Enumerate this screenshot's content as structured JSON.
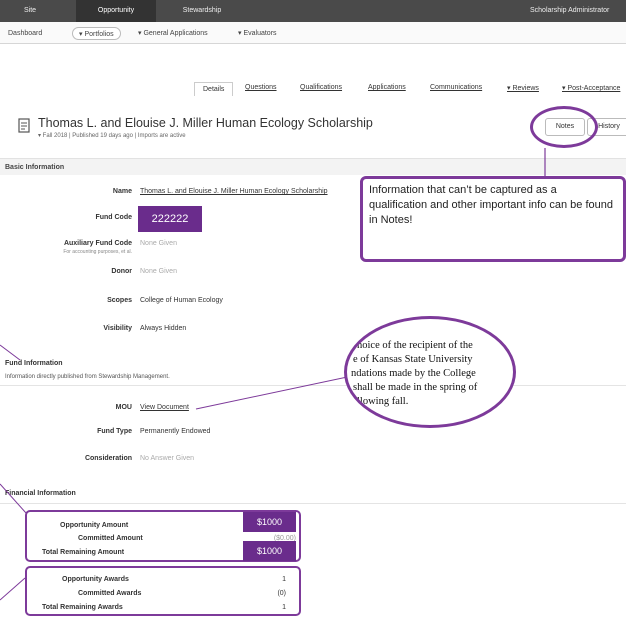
{
  "topnav": {
    "items": [
      {
        "label": "Site",
        "active": false
      },
      {
        "label": "Opportunity",
        "active": true
      },
      {
        "label": "Stewardship",
        "active": false
      }
    ],
    "right_label": "Scholarship Administrator"
  },
  "subnav": {
    "items": [
      "Dashboard",
      "▾ Portfolios",
      "▾ General Applications",
      "▾ Evaluators"
    ]
  },
  "tabs": [
    "Details",
    "Questions",
    "Qualifications",
    "Applications",
    "Communications",
    "▾ Reviews",
    "▾ Post-Acceptance"
  ],
  "header": {
    "title": "Thomas L. and Elouise J. Miller Human Ecology Scholarship",
    "meta": "▾ Fall 2018  |  Published 19 days ago  |  Imports are active",
    "notes_button": "Notes",
    "history_button": "History"
  },
  "basic_info": {
    "heading": "Basic Information",
    "name_label": "Name",
    "name_value": "Thomas L. and Elouise J. Miller Human Ecology Scholarship",
    "fund_code_label": "Fund Code",
    "fund_code_value": "222222",
    "aux_label": "Auxiliary Fund Code",
    "aux_sub": "For accounting purposes, et al.",
    "aux_value": "None Given",
    "donor_label": "Donor",
    "donor_value": "None Given",
    "scopes_label": "Scopes",
    "scopes_value": "College of Human Ecology",
    "visibility_label": "Visibility",
    "visibility_value": "Always Hidden"
  },
  "fund_info": {
    "heading": "Fund Information",
    "sub": "Information directly published from Stewardship Management.",
    "mou_label": "MOU",
    "mou_value": "View Document",
    "type_label": "Fund Type",
    "type_value": "Permanently Endowed",
    "consideration_label": "Consideration",
    "consideration_value": "No Answer Given"
  },
  "financial": {
    "heading": "Financial Information",
    "amount_rows": [
      {
        "label": "Opportunity Amount",
        "value": "$1000"
      },
      {
        "label": "Committed Amount",
        "value": "($0.00)"
      },
      {
        "label": "Total Remaining Amount",
        "value": "$1000"
      }
    ],
    "award_rows": [
      {
        "label": "Opportunity Awards",
        "value": "1"
      },
      {
        "label": "Committed Awards",
        "value": "(0)"
      },
      {
        "label": "Total Remaining Awards",
        "value": "1"
      }
    ]
  },
  "annotations": {
    "notes_callout": "Information that can’t be captured as a qualification and other important info can be found in Notes!",
    "mou_quote": [
      "hoice of the recipient of the",
      "e of Kansas State University",
      "ndations made by the College",
      "shall be made in the spring of",
      "llowing fall."
    ],
    "accent_color": "#7d3a9a",
    "highlight_color": "#6a2c8c"
  }
}
